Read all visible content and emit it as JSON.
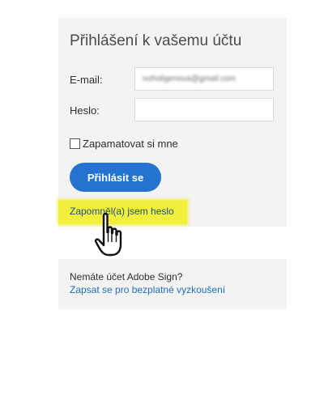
{
  "login": {
    "title": "Přihlášení k vašemu účtu",
    "email_label": "E-mail:",
    "email_value": "noholigenova@gmail.com",
    "password_label": "Heslo:",
    "password_value": "",
    "remember_label": "Zapamatovat si mne",
    "remember_checked": false,
    "submit_label": "Přihlásit se",
    "forgot_label": "Zapomněl(a) jsem heslo"
  },
  "signup": {
    "question": "Nemáte účet Adobe Sign?",
    "link_label": "Zapsat se pro bezplatné vyzkoušení"
  },
  "colors": {
    "panel_bg": "#f3f3f3",
    "primary_button": "#2473ce",
    "highlight": "#f2ee3c",
    "link": "#1c6fc0"
  },
  "icons": {
    "cursor": "hand-pointer-icon"
  }
}
